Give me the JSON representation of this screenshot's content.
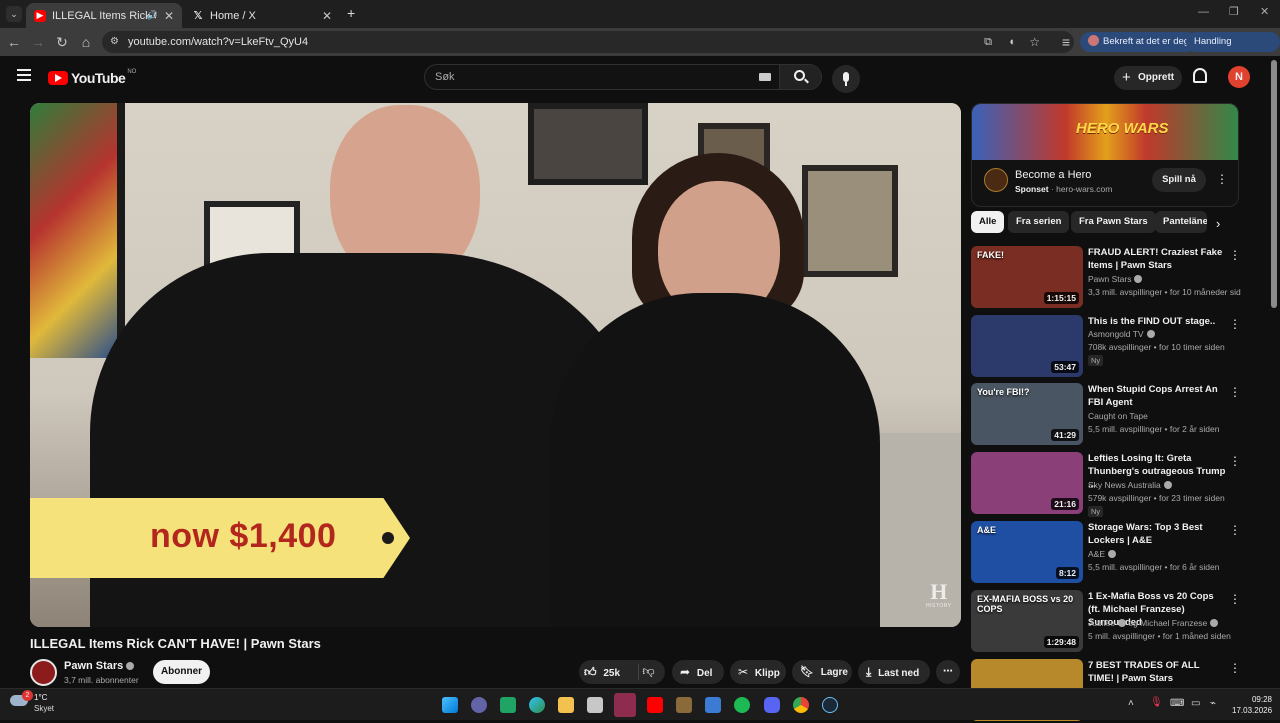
{
  "browser": {
    "tabs": [
      {
        "title": "ILLEGAL Items Rick CAN'T H",
        "active": true
      },
      {
        "title": "Home / X",
        "active": false
      }
    ],
    "new_tab": "+",
    "url": "youtube.com/watch?v=LkeFtv_QyU4",
    "profile_pill": "Bekreft at det er deg",
    "action_pill": "Handling påkrevd"
  },
  "youtube": {
    "logo_text": "YouTube",
    "region": "NO",
    "search_placeholder": "Søk",
    "create_label": "Opprett",
    "avatar_letter": "N"
  },
  "video": {
    "overlay_price": "now $1,400",
    "corner_mark": "H",
    "corner_mark_sub": "HISTORY",
    "title": "ILLEGAL Items Rick CAN'T HAVE! | Pawn Stars",
    "channel": "Pawn Stars",
    "subscribers": "3,7 mill. abonnenter",
    "subscribe_label": "Abonner",
    "likes": "25k",
    "share_label": "Del",
    "clip_label": "Klipp",
    "save_label": "Lagre",
    "download_label": "Last ned"
  },
  "ad": {
    "banner_text": "HERO WARS",
    "title": "Become a Hero",
    "sponsor_label": "Sponset",
    "domain": "hero-wars.com",
    "cta": "Spill nå"
  },
  "chips": [
    "Alle",
    "Fra serien",
    "Fra Pawn Stars",
    "Panteläne"
  ],
  "recommendations": [
    {
      "title": "FRAUD ALERT! Craziest Fake Items | Pawn Stars",
      "channel": "Pawn Stars",
      "verified": true,
      "meta": "3,3 mill. avspillinger • for 10 måneder sid",
      "duration": "1:15:15",
      "new": "",
      "thumb_color": "#7a2d22",
      "thumb_text": "FAKE!"
    },
    {
      "title": "This is the FIND OUT stage..",
      "channel": "Asmongold TV",
      "verified": true,
      "meta": "708k avspillinger • for 10 timer siden",
      "duration": "53:47",
      "new": "Ny",
      "thumb_color": "#2b3a6b",
      "thumb_text": ""
    },
    {
      "title": "When Stupid Cops Arrest An FBI Agent",
      "channel": "Caught on Tape",
      "verified": false,
      "meta": "5,5 mill. avspillinger • for 2 år siden",
      "duration": "41:29",
      "new": "",
      "thumb_color": "#4a5563",
      "thumb_text": "You're FBI!?"
    },
    {
      "title": "Lefties Losing It: Greta Thunberg's outrageous Trump ...",
      "channel": "Sky News Australia",
      "verified": true,
      "meta": "579k avspillinger • for 23 timer siden",
      "duration": "21:16",
      "new": "Ny",
      "thumb_color": "#8a3f78",
      "thumb_text": ""
    },
    {
      "title": "Storage Wars: Top 3 Best Lockers | A&E",
      "channel": "A&E",
      "verified": true,
      "meta": "5,5 mill. avspillinger • for 6 år siden",
      "duration": "8:12",
      "new": "",
      "thumb_color": "#1f4fa3",
      "thumb_text": "A&E"
    },
    {
      "title": "1 Ex-Mafia Boss vs 20 Cops (ft. Michael Franzese) Surrounded",
      "channel": "Jubilee",
      "verified": true,
      "channel_extra": "og Michael Franzese",
      "meta": "5 mill. avspillinger • for 1 måned siden",
      "duration": "1:29:48",
      "new": "",
      "thumb_color": "#3a3a3a",
      "thumb_text": "EX-MAFIA BOSS vs 20 COPS"
    },
    {
      "title": "7 BEST TRADES OF ALL TIME! | Pawn Stars",
      "channel": "",
      "verified": false,
      "meta": "",
      "duration": "",
      "new": "",
      "thumb_color": "#b8892a",
      "thumb_text": ""
    }
  ],
  "taskbar": {
    "weather_temp": "1°C",
    "weather_desc": "Skyet",
    "weather_badge": "2",
    "time": "09:28",
    "date": "17.03.2026"
  },
  "colors": {
    "youtube_red": "#ff0000",
    "price_tag": "#f6e27a",
    "price_text": "#b3261e",
    "avatar": "#e1422f",
    "pill_blue": "#2b4a7a"
  }
}
